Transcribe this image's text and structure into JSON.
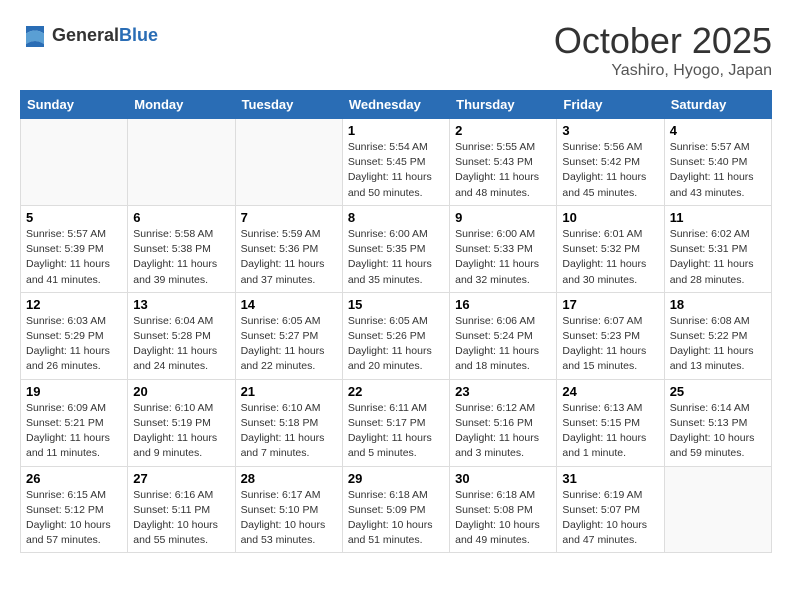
{
  "header": {
    "logo_general": "General",
    "logo_blue": "Blue",
    "month": "October 2025",
    "location": "Yashiro, Hyogo, Japan"
  },
  "weekdays": [
    "Sunday",
    "Monday",
    "Tuesday",
    "Wednesday",
    "Thursday",
    "Friday",
    "Saturday"
  ],
  "weeks": [
    [
      {
        "day": "",
        "info": ""
      },
      {
        "day": "",
        "info": ""
      },
      {
        "day": "",
        "info": ""
      },
      {
        "day": "1",
        "info": "Sunrise: 5:54 AM\nSunset: 5:45 PM\nDaylight: 11 hours\nand 50 minutes."
      },
      {
        "day": "2",
        "info": "Sunrise: 5:55 AM\nSunset: 5:43 PM\nDaylight: 11 hours\nand 48 minutes."
      },
      {
        "day": "3",
        "info": "Sunrise: 5:56 AM\nSunset: 5:42 PM\nDaylight: 11 hours\nand 45 minutes."
      },
      {
        "day": "4",
        "info": "Sunrise: 5:57 AM\nSunset: 5:40 PM\nDaylight: 11 hours\nand 43 minutes."
      }
    ],
    [
      {
        "day": "5",
        "info": "Sunrise: 5:57 AM\nSunset: 5:39 PM\nDaylight: 11 hours\nand 41 minutes."
      },
      {
        "day": "6",
        "info": "Sunrise: 5:58 AM\nSunset: 5:38 PM\nDaylight: 11 hours\nand 39 minutes."
      },
      {
        "day": "7",
        "info": "Sunrise: 5:59 AM\nSunset: 5:36 PM\nDaylight: 11 hours\nand 37 minutes."
      },
      {
        "day": "8",
        "info": "Sunrise: 6:00 AM\nSunset: 5:35 PM\nDaylight: 11 hours\nand 35 minutes."
      },
      {
        "day": "9",
        "info": "Sunrise: 6:00 AM\nSunset: 5:33 PM\nDaylight: 11 hours\nand 32 minutes."
      },
      {
        "day": "10",
        "info": "Sunrise: 6:01 AM\nSunset: 5:32 PM\nDaylight: 11 hours\nand 30 minutes."
      },
      {
        "day": "11",
        "info": "Sunrise: 6:02 AM\nSunset: 5:31 PM\nDaylight: 11 hours\nand 28 minutes."
      }
    ],
    [
      {
        "day": "12",
        "info": "Sunrise: 6:03 AM\nSunset: 5:29 PM\nDaylight: 11 hours\nand 26 minutes."
      },
      {
        "day": "13",
        "info": "Sunrise: 6:04 AM\nSunset: 5:28 PM\nDaylight: 11 hours\nand 24 minutes."
      },
      {
        "day": "14",
        "info": "Sunrise: 6:05 AM\nSunset: 5:27 PM\nDaylight: 11 hours\nand 22 minutes."
      },
      {
        "day": "15",
        "info": "Sunrise: 6:05 AM\nSunset: 5:26 PM\nDaylight: 11 hours\nand 20 minutes."
      },
      {
        "day": "16",
        "info": "Sunrise: 6:06 AM\nSunset: 5:24 PM\nDaylight: 11 hours\nand 18 minutes."
      },
      {
        "day": "17",
        "info": "Sunrise: 6:07 AM\nSunset: 5:23 PM\nDaylight: 11 hours\nand 15 minutes."
      },
      {
        "day": "18",
        "info": "Sunrise: 6:08 AM\nSunset: 5:22 PM\nDaylight: 11 hours\nand 13 minutes."
      }
    ],
    [
      {
        "day": "19",
        "info": "Sunrise: 6:09 AM\nSunset: 5:21 PM\nDaylight: 11 hours\nand 11 minutes."
      },
      {
        "day": "20",
        "info": "Sunrise: 6:10 AM\nSunset: 5:19 PM\nDaylight: 11 hours\nand 9 minutes."
      },
      {
        "day": "21",
        "info": "Sunrise: 6:10 AM\nSunset: 5:18 PM\nDaylight: 11 hours\nand 7 minutes."
      },
      {
        "day": "22",
        "info": "Sunrise: 6:11 AM\nSunset: 5:17 PM\nDaylight: 11 hours\nand 5 minutes."
      },
      {
        "day": "23",
        "info": "Sunrise: 6:12 AM\nSunset: 5:16 PM\nDaylight: 11 hours\nand 3 minutes."
      },
      {
        "day": "24",
        "info": "Sunrise: 6:13 AM\nSunset: 5:15 PM\nDaylight: 11 hours\nand 1 minute."
      },
      {
        "day": "25",
        "info": "Sunrise: 6:14 AM\nSunset: 5:13 PM\nDaylight: 10 hours\nand 59 minutes."
      }
    ],
    [
      {
        "day": "26",
        "info": "Sunrise: 6:15 AM\nSunset: 5:12 PM\nDaylight: 10 hours\nand 57 minutes."
      },
      {
        "day": "27",
        "info": "Sunrise: 6:16 AM\nSunset: 5:11 PM\nDaylight: 10 hours\nand 55 minutes."
      },
      {
        "day": "28",
        "info": "Sunrise: 6:17 AM\nSunset: 5:10 PM\nDaylight: 10 hours\nand 53 minutes."
      },
      {
        "day": "29",
        "info": "Sunrise: 6:18 AM\nSunset: 5:09 PM\nDaylight: 10 hours\nand 51 minutes."
      },
      {
        "day": "30",
        "info": "Sunrise: 6:18 AM\nSunset: 5:08 PM\nDaylight: 10 hours\nand 49 minutes."
      },
      {
        "day": "31",
        "info": "Sunrise: 6:19 AM\nSunset: 5:07 PM\nDaylight: 10 hours\nand 47 minutes."
      },
      {
        "day": "",
        "info": ""
      }
    ]
  ]
}
